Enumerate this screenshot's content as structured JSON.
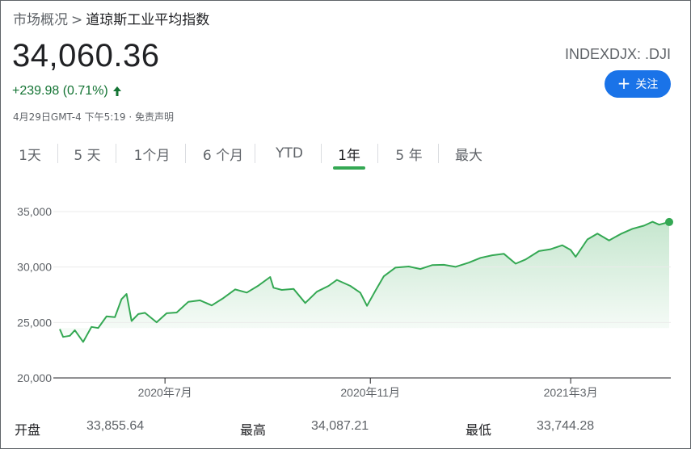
{
  "breadcrumb": {
    "root": "市场概况",
    "separator": ">",
    "current": "道琼斯工业平均指数"
  },
  "quote": {
    "price": "34,060.36",
    "ticker": "INDEXDJX: .DJI",
    "change": "+239.98 (0.71%)",
    "change_direction": "up",
    "change_color": "#137333",
    "timestamp": "4月29日GMT-4 下午5:19",
    "disclaimer": "· 免责声明"
  },
  "follow_button": {
    "label": "关注",
    "icon": "plus-icon",
    "color": "#1a73e8"
  },
  "range_tabs": [
    {
      "label": "1天",
      "active": false
    },
    {
      "label": "5 天",
      "active": false
    },
    {
      "label": "1个月",
      "active": false
    },
    {
      "label": "6 个月",
      "active": false
    },
    {
      "label": "YTD",
      "active": false
    },
    {
      "label": "1年",
      "active": true
    },
    {
      "label": "5 年",
      "active": false
    },
    {
      "label": "最大",
      "active": false
    }
  ],
  "stats": [
    {
      "label": "开盘",
      "value": "33,855.64"
    },
    {
      "label": "最高",
      "value": "34,087.21"
    },
    {
      "label": "最低",
      "value": "33,744.28"
    }
  ],
  "chart_data": {
    "type": "area",
    "line_color": "#34a853",
    "ylim": [
      20000,
      35500
    ],
    "y_ticks": [
      20000,
      25000,
      30000,
      35000
    ],
    "y_tick_labels": [
      "20,000",
      "25,000",
      "30,000",
      "35,000"
    ],
    "x_tick_labels": [
      "2020年7月",
      "2020年11月",
      "2021年3月"
    ],
    "x_tick_dates": [
      "2020-07-01",
      "2020-11-01",
      "2021-03-01"
    ],
    "x_range": [
      "2020-04-29",
      "2021-04-29"
    ],
    "grid": true,
    "series": [
      {
        "points": [
          [
            "2020-04-29",
            24400
          ],
          [
            "2020-05-01",
            23700
          ],
          [
            "2020-05-05",
            23800
          ],
          [
            "2020-05-08",
            24300
          ],
          [
            "2020-05-13",
            23250
          ],
          [
            "2020-05-18",
            24600
          ],
          [
            "2020-05-22",
            24500
          ],
          [
            "2020-05-27",
            25550
          ],
          [
            "2020-06-01",
            25480
          ],
          [
            "2020-06-05",
            27110
          ],
          [
            "2020-06-08",
            27570
          ],
          [
            "2020-06-11",
            25130
          ],
          [
            "2020-06-15",
            25760
          ],
          [
            "2020-06-19",
            25870
          ],
          [
            "2020-06-26",
            25020
          ],
          [
            "2020-07-02",
            25830
          ],
          [
            "2020-07-08",
            25900
          ],
          [
            "2020-07-15",
            26870
          ],
          [
            "2020-07-22",
            27000
          ],
          [
            "2020-07-29",
            26540
          ],
          [
            "2020-08-05",
            27200
          ],
          [
            "2020-08-12",
            27980
          ],
          [
            "2020-08-19",
            27700
          ],
          [
            "2020-08-26",
            28330
          ],
          [
            "2020-09-02",
            29100
          ],
          [
            "2020-09-04",
            28130
          ],
          [
            "2020-09-09",
            27940
          ],
          [
            "2020-09-16",
            28030
          ],
          [
            "2020-09-23",
            26760
          ],
          [
            "2020-09-30",
            27780
          ],
          [
            "2020-10-07",
            28300
          ],
          [
            "2020-10-12",
            28840
          ],
          [
            "2020-10-20",
            28300
          ],
          [
            "2020-10-26",
            27690
          ],
          [
            "2020-10-30",
            26500
          ],
          [
            "2020-11-04",
            27850
          ],
          [
            "2020-11-09",
            29160
          ],
          [
            "2020-11-16",
            29950
          ],
          [
            "2020-11-24",
            30050
          ],
          [
            "2020-12-01",
            29820
          ],
          [
            "2020-12-08",
            30170
          ],
          [
            "2020-12-15",
            30200
          ],
          [
            "2020-12-22",
            30020
          ],
          [
            "2020-12-30",
            30400
          ],
          [
            "2021-01-06",
            30830
          ],
          [
            "2021-01-13",
            31060
          ],
          [
            "2021-01-20",
            31190
          ],
          [
            "2021-01-27",
            30300
          ],
          [
            "2021-02-02",
            30680
          ],
          [
            "2021-02-10",
            31440
          ],
          [
            "2021-02-17",
            31610
          ],
          [
            "2021-02-24",
            31960
          ],
          [
            "2021-03-01",
            31540
          ],
          [
            "2021-03-04",
            30920
          ],
          [
            "2021-03-11",
            32490
          ],
          [
            "2021-03-17",
            33010
          ],
          [
            "2021-03-24",
            32400
          ],
          [
            "2021-03-31",
            32980
          ],
          [
            "2021-04-07",
            33450
          ],
          [
            "2021-04-14",
            33730
          ],
          [
            "2021-04-19",
            34080
          ],
          [
            "2021-04-23",
            33820
          ],
          [
            "2021-04-29",
            34060
          ]
        ]
      }
    ]
  }
}
